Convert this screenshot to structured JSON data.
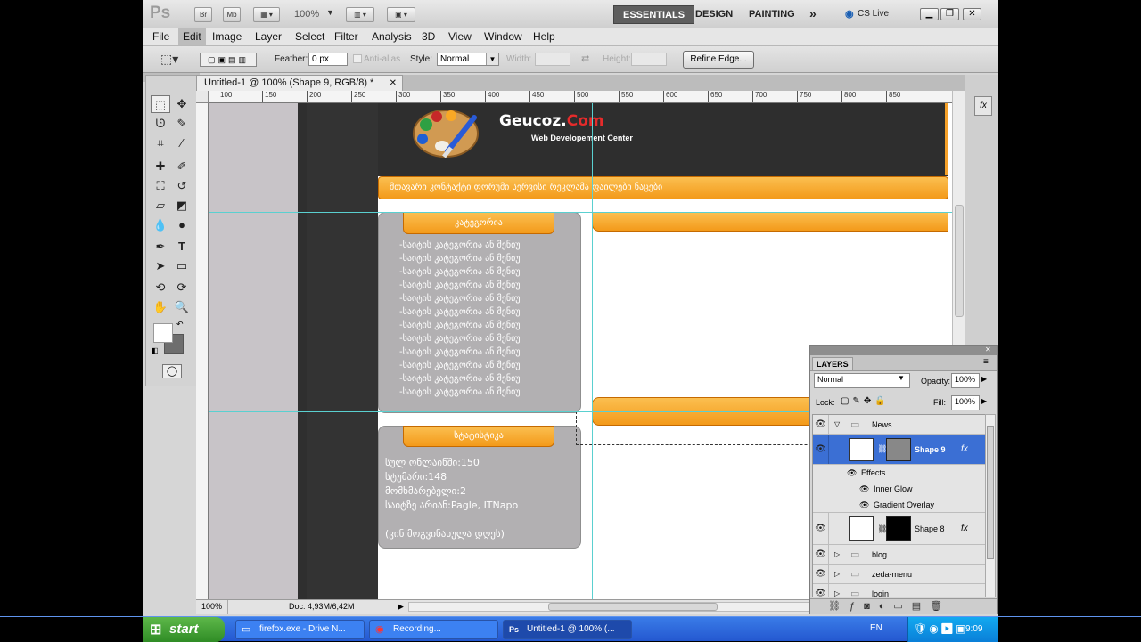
{
  "appbar": {
    "logo": "Ps",
    "zoom": "100%",
    "workspaces": [
      "ESSENTIALS",
      "DESIGN",
      "PAINTING"
    ],
    "more": "»",
    "cslive": "CS Live",
    "br": "Br",
    "mb": "Mb"
  },
  "menu": [
    "File",
    "Edit",
    "Image",
    "Layer",
    "Select",
    "Filter",
    "Analysis",
    "3D",
    "View",
    "Window",
    "Help"
  ],
  "options": {
    "feather_label": "Feather:",
    "feather_value": "0 px",
    "antialias_label": "Anti-alias",
    "style_label": "Style:",
    "style_value": "Normal",
    "width_label": "Width:",
    "height_label": "Height:",
    "refine_button": "Refine Edge..."
  },
  "document": {
    "tab_title": "Untitled-1 @ 100% (Shape 9, RGB/8) *",
    "zoom": "100%",
    "doc_info": "Doc: 4,93M/6,42M",
    "ruler_ticks": [
      "100",
      "150",
      "200",
      "250",
      "300",
      "350",
      "400",
      "450",
      "500",
      "550",
      "600",
      "650",
      "700",
      "750",
      "800",
      "850"
    ]
  },
  "website": {
    "brand_g": "G",
    "brand_rest": "eucoz.",
    "brand_com": "Com",
    "tagline": "Web Developement Center",
    "nav": "მთავარი კონტაქტი ფორუმი სერვისი რეკლამა ფაილები ნაცები",
    "categories_title": "კატეგორია",
    "category_item": "-საიტის კატეგორია ან მენიუ",
    "category_count": 12,
    "stats_title": "სტატისტიკა",
    "stats": [
      "სულ ონლაინში:150",
      "სტუმარი:148",
      "მომხმარებელი:2",
      "საიტზე არიან:Pagle, ITNapo"
    ],
    "who_visited": "(ვინ მოგვინახულა დღეს)"
  },
  "layers": {
    "title": "LAYERS",
    "blend_mode": "Normal",
    "opacity_label": "Opacity:",
    "opacity_value": "100%",
    "lock_label": "Lock:",
    "fill_label": "Fill:",
    "fill_value": "100%",
    "items": [
      {
        "name": "News"
      },
      {
        "name": "Shape 9"
      },
      {
        "name": "Effects"
      },
      {
        "name": "Inner Glow"
      },
      {
        "name": "Gradient Overlay"
      },
      {
        "name": "Shape 8"
      },
      {
        "name": "blog"
      },
      {
        "name": "zeda-menu"
      },
      {
        "name": "login"
      }
    ],
    "fx": "fx"
  },
  "taskbar": {
    "start": "start",
    "tasks": [
      "firefox.exe - Drive N...",
      "Recording...",
      "Untitled-1 @ 100% (..."
    ],
    "lang": "EN",
    "time": "9:09"
  }
}
